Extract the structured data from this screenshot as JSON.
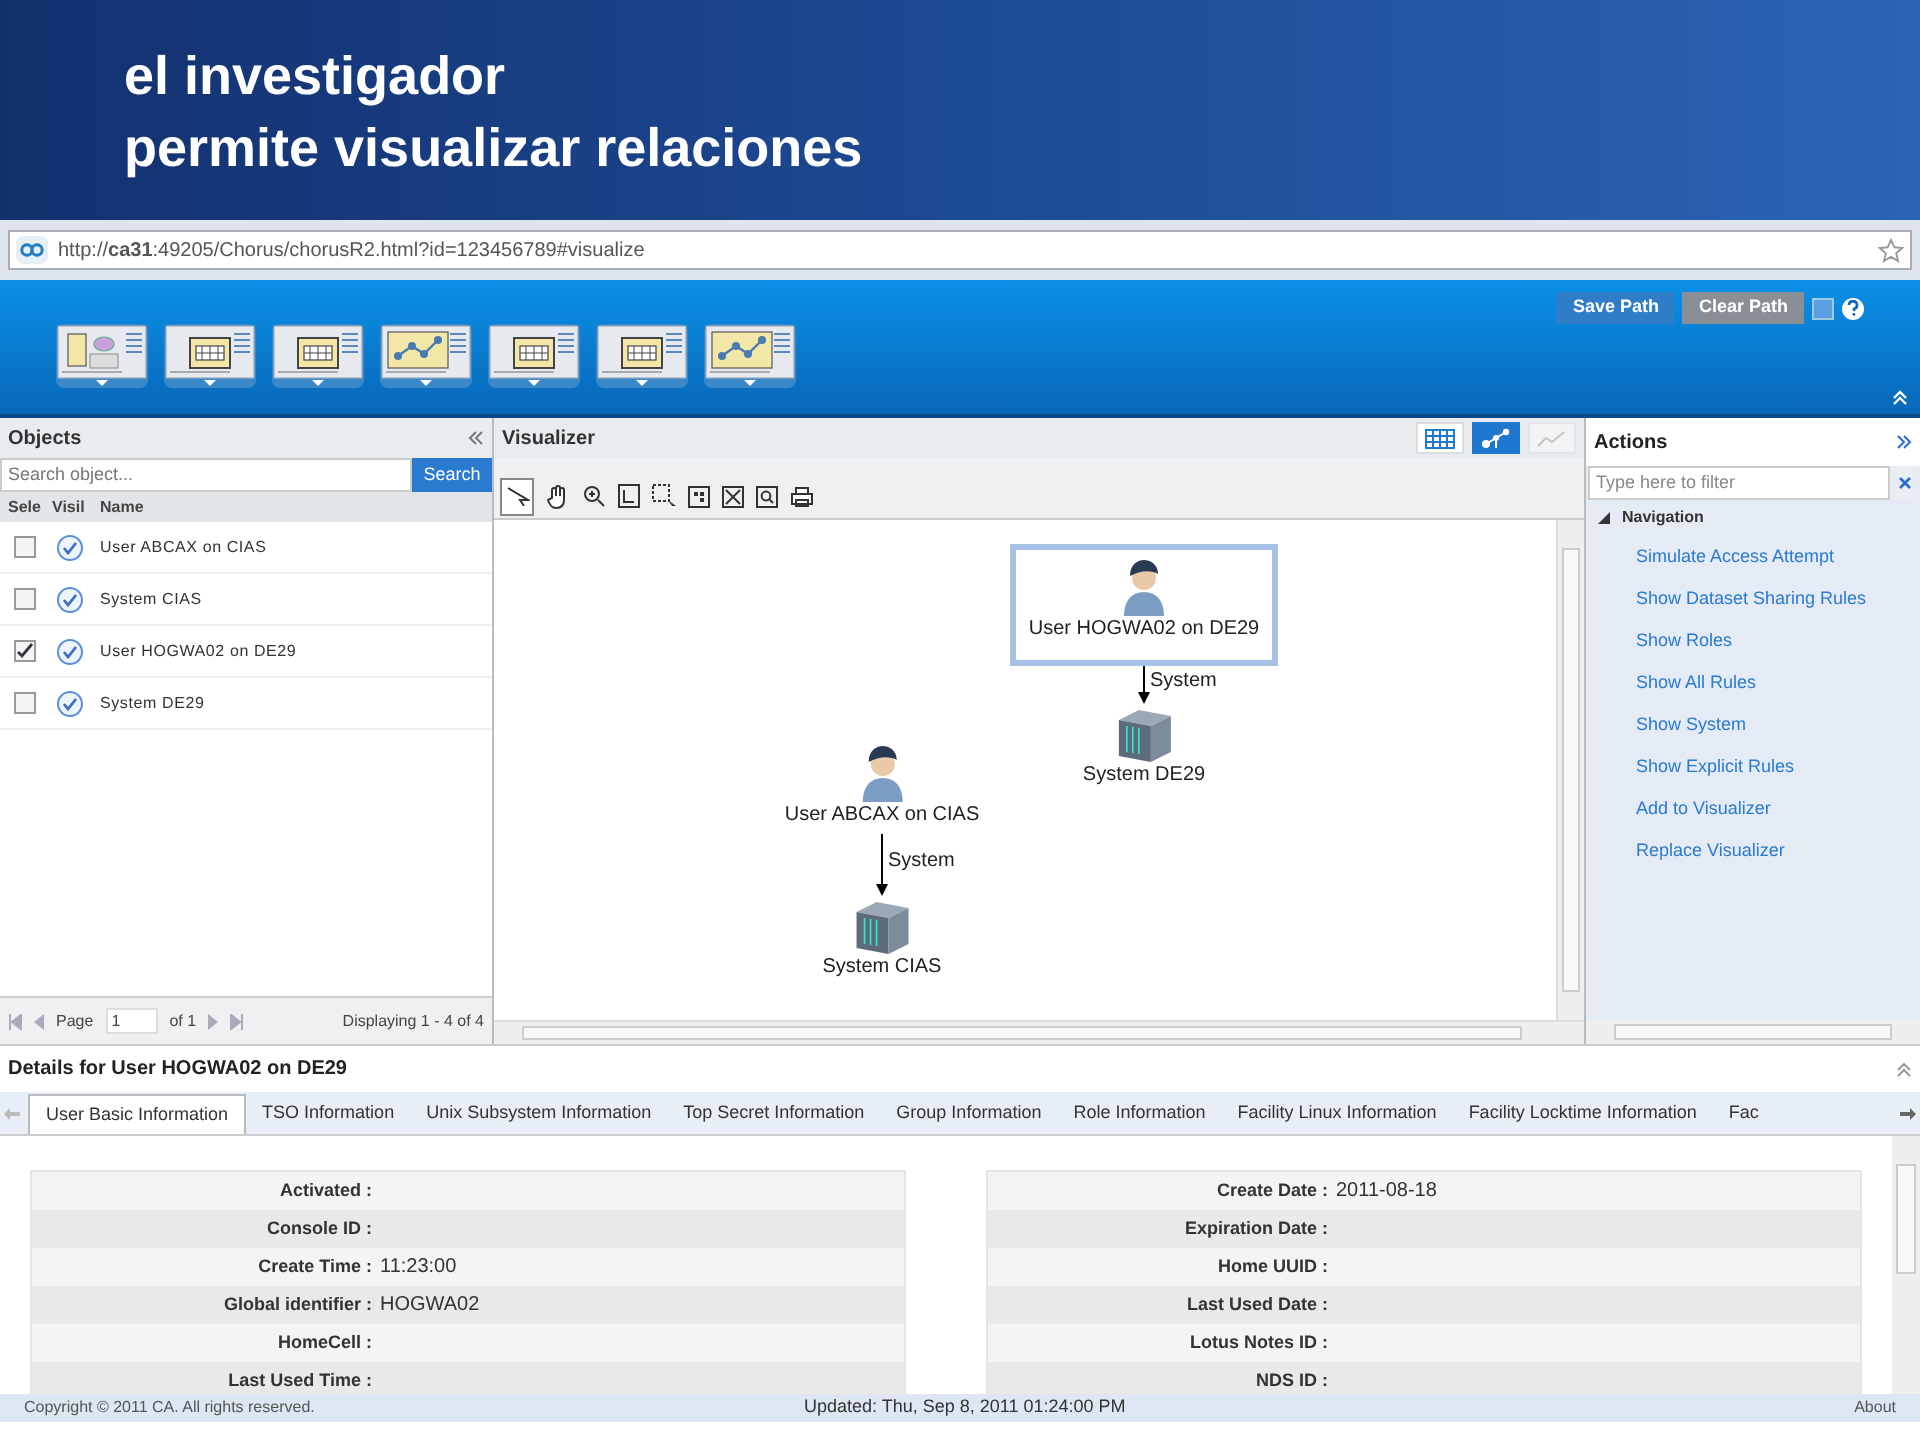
{
  "slide_title": [
    "el investigador",
    "permite visualizar relaciones"
  ],
  "browser": {
    "url": "http://**ca31**:49205/Chorus/chorusR2.html?id=123456789#visualize"
  },
  "toolbar": {
    "views": [
      {
        "kind": "dashboard"
      },
      {
        "kind": "table"
      },
      {
        "kind": "table"
      },
      {
        "kind": "graph"
      },
      {
        "kind": "table"
      },
      {
        "kind": "table"
      },
      {
        "kind": "graph"
      }
    ],
    "buttons": [
      {
        "label": "Save Path",
        "kind": "primary"
      },
      {
        "label": "Clear Path",
        "kind": "secondary"
      }
    ]
  },
  "objects": {
    "title": "Objects",
    "search_placeholder": "Search object...",
    "search_button": "Search",
    "columns": [
      "Sele",
      "Visil",
      "Name"
    ],
    "rows": [
      {
        "name": "User ABCAX on CIAS",
        "checked": false,
        "visible": true
      },
      {
        "name": "System CIAS",
        "checked": false,
        "visible": true
      },
      {
        "name": "User HOGWA02 on DE29",
        "checked": true,
        "visible": true
      },
      {
        "name": "System DE29",
        "checked": false,
        "visible": true
      }
    ],
    "pager": {
      "label": "Page",
      "page": "1",
      "of": "of 1",
      "display": "Displaying 1 - 4 of 4"
    }
  },
  "visualizer": {
    "title": "Visualizer",
    "views": [
      {
        "kind": "grid",
        "selected": false,
        "disabled": false
      },
      {
        "kind": "graph",
        "selected": true,
        "disabled": false
      },
      {
        "kind": "chart",
        "selected": false,
        "disabled": true
      }
    ],
    "nodes": [
      {
        "kind": "user",
        "label": "User HOGWA02 on DE29",
        "selected": true
      },
      {
        "kind": "system",
        "label": "System DE29",
        "selected": false
      },
      {
        "kind": "user",
        "label": "User ABCAX on CIAS",
        "selected": false
      },
      {
        "kind": "system",
        "label": "System CIAS",
        "selected": false
      }
    ],
    "edges": [
      {
        "label": "System"
      },
      {
        "label": "System"
      }
    ]
  },
  "actions": {
    "title": "Actions",
    "filter_placeholder": "Type here to filter",
    "group": {
      "label": "Navigation",
      "expanded": true
    },
    "items": [
      "Simulate Access Attempt",
      "Show Dataset Sharing Rules",
      "Show Roles",
      "Show All Rules",
      "Show System",
      "Show Explicit Rules",
      "Add to Visualizer",
      "Replace Visualizer"
    ]
  },
  "details": {
    "title": "Details for User HOGWA02 on DE29",
    "tabs": [
      {
        "label": "User Basic Information",
        "selected": true
      },
      {
        "label": "TSO Information",
        "selected": false
      },
      {
        "label": "Unix Subsystem Information",
        "selected": false
      },
      {
        "label": "Top Secret Information",
        "selected": false
      },
      {
        "label": "Group Information",
        "selected": false
      },
      {
        "label": "Role Information",
        "selected": false
      },
      {
        "label": "Facility Linux Information",
        "selected": false
      },
      {
        "label": "Facility Locktime Information",
        "selected": false
      },
      {
        "label": "Fac",
        "selected": false
      }
    ],
    "left_fields": [
      {
        "label": "Activated :"
      },
      {
        "label": "Console ID :"
      },
      {
        "label": "Create Time :",
        "value": "11:23:00"
      },
      {
        "label": "Global identifier :",
        "value": "HOGWA02"
      },
      {
        "label": "HomeCell :"
      },
      {
        "label": "Last Used Time :"
      }
    ],
    "right_fields": [
      {
        "label": "Create Date :",
        "value": "2011-08-18"
      },
      {
        "label": "Expiration Date :"
      },
      {
        "label": "Home UUID :"
      },
      {
        "label": "Last Used Date :"
      },
      {
        "label": "Lotus Notes ID :"
      },
      {
        "label": "NDS ID :"
      }
    ]
  },
  "footer": {
    "copyright": "Copyright © 2011 CA. All rights reserved.",
    "updated": "Updated: Thu, Sep 8, 2011 01:24:00 PM",
    "about": "About"
  }
}
